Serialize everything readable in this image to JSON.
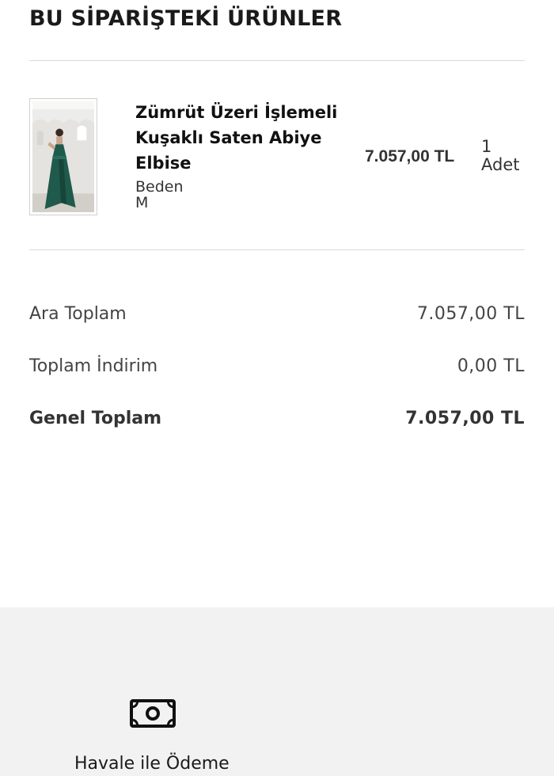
{
  "order_items": {
    "title": "BU SİPARİŞTEKİ ÜRÜNLER",
    "items": [
      {
        "name": "Zümrüt Üzeri İşlemeli Kuşaklı Saten Abiye Elbise",
        "variant_label": "Beden",
        "variant_value": "M",
        "price": "7.057,00 TL",
        "quantity": "1",
        "quantity_unit": "Adet",
        "image_icon": "green-satin-dress-photo"
      }
    ]
  },
  "summary": {
    "subtotal_label": "Ara Toplam",
    "subtotal_value": "7.057,00 TL",
    "discount_label": "Toplam İndirim",
    "discount_value": "0,00 TL",
    "total_label": "Genel Toplam",
    "total_value": "7.057,00 TL"
  },
  "payment": {
    "method_label": "Havale ile Ödeme",
    "icon": "cash-icon"
  },
  "colors": {
    "panel_bg": "#f2f2f2",
    "divider": "#d9d9d9",
    "dress_green": "#1f5a4c"
  }
}
